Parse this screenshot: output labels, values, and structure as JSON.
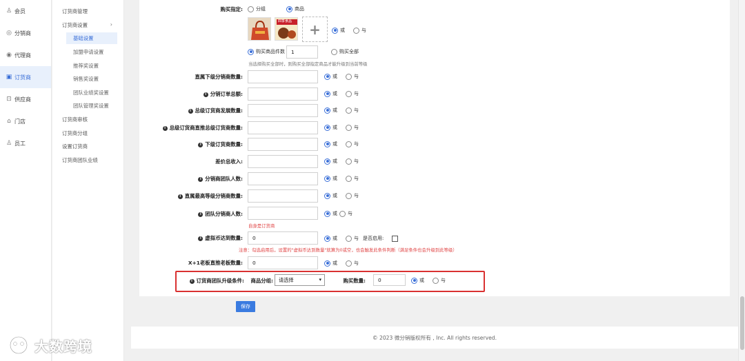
{
  "sidebar_primary": {
    "items": [
      {
        "label": "会员",
        "icon": "user-icon",
        "active": false
      },
      {
        "label": "分销商",
        "icon": "distributor-icon",
        "active": false
      },
      {
        "label": "代理商",
        "icon": "agent-icon",
        "active": false
      },
      {
        "label": "订货商",
        "icon": "orders-icon",
        "active": true
      },
      {
        "label": "供应商",
        "icon": "supplier-icon",
        "active": false
      },
      {
        "label": "门店",
        "icon": "store-icon",
        "active": false
      },
      {
        "label": "员工",
        "icon": "staff-icon",
        "active": false
      }
    ]
  },
  "sidebar_secondary": {
    "items": [
      {
        "label": "订货商管理"
      },
      {
        "label": "订货商设置"
      },
      {
        "label": "基础设置"
      },
      {
        "label": "加盟申请设置"
      },
      {
        "label": "推荐奖设置"
      },
      {
        "label": "销售奖设置"
      },
      {
        "label": "团队业绩奖设置"
      },
      {
        "label": "团队管理奖设置"
      },
      {
        "label": "订货商审核"
      },
      {
        "label": "订货商分组"
      },
      {
        "label": "设置订货商"
      },
      {
        "label": "订货商团队业绩"
      }
    ],
    "chevron": "›"
  },
  "form": {
    "buy_label": "购买指定:",
    "opt_group": "分组",
    "opt_goods": "商品",
    "or": "或",
    "and": "与",
    "buy_count_label": "购买商品件数",
    "buy_count_value": "1",
    "buy_all_label": "购买全部",
    "buy_all_note": "当选择购买全部时，则购买全部指定商品才能升级到当前等级",
    "add_symbol": "+",
    "thumb2_text": "四季食品",
    "fields": [
      {
        "label": "直属下级分销商数量:",
        "info": false,
        "value": ""
      },
      {
        "label": "分销订单总额:",
        "info": true,
        "value": ""
      },
      {
        "label": "总级订货商发展数量:",
        "info": true,
        "value": ""
      },
      {
        "label": "总级订货商直推总级订货商数量:",
        "info": true,
        "value": ""
      },
      {
        "label": "下级订货商数量:",
        "info": true,
        "value": ""
      },
      {
        "label": "差价总收入:",
        "info": false,
        "value": ""
      },
      {
        "label": "分销商团队人数:",
        "info": true,
        "value": ""
      },
      {
        "label": "直属最高等级分销商数量:",
        "info": true,
        "value": ""
      },
      {
        "label": "团队分销商人数:",
        "info": true,
        "value": ""
      }
    ],
    "self_note": "自身是订货商",
    "virtual_label": "虚拟币达到数量:",
    "virtual_value": "0",
    "enable_label": "是否启用:",
    "virtual_note": "注意：勾选启用后，设置的\"虚拟币达到数量\"就算为0或空，也会触发此条件判断（满足条件也会升级到此等级）",
    "x1_label": "X+1老板直推老板数量:",
    "x1_value": "0",
    "team_upgrade_label": "订货商团队升级条件:",
    "goods_group_label": "商品分组:",
    "select_placeholder": "请选择",
    "buy_qty_label": "购买数量:",
    "buy_qty_value": "0",
    "save_label": "保存"
  },
  "footer": {
    "copyright": "© 2023 微分销版权所有 , Inc. All rights reserved."
  },
  "watermark": {
    "text": "大数跨境"
  },
  "colors": {
    "accent": "#3a6fd8",
    "highlight": "#d93030",
    "warning_text": "#e04444"
  }
}
